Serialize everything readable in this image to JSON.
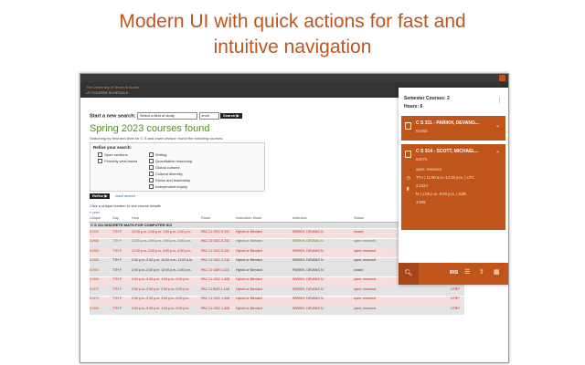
{
  "headline": {
    "line1": "Modern UI with quick actions for fast and",
    "line2": "intuitive navigation"
  },
  "site": {
    "logo_line1": "The University of Texas at Austin",
    "logo_line2": "UT COURSE SCHEDULE"
  },
  "search": {
    "label": "Start a new search:",
    "field_placeholder": "Select a field of study",
    "level_value": "level",
    "button": "Search ▶"
  },
  "results": {
    "title": "Spring 2023 courses found",
    "subtitle": "Searching by field and level for C S and lower-division found the following courses."
  },
  "refine": {
    "title": "Refine your search:",
    "options_left": [
      "Open sections",
      "Primarily web-based"
    ],
    "options_right": [
      "Writing",
      "Quantitative reasoning",
      "Global cultures",
      "Cultural diversity",
      "Ethics and leadership",
      "Independent inquiry"
    ],
    "button": "Refine ▶",
    "reset": "reset search"
  },
  "list": {
    "click_info": "Click a unique number to see course details.",
    "prev": "« prev",
    "headers": [
      "Unique",
      "Day",
      "Hour",
      "Room",
      "Instruction Mode",
      "Instructor",
      "Status",
      ""
    ],
    "course_header": "C S 311 DISCRETE MATH FOR COMPUTER SCI",
    "rows": [
      {
        "unique": "51940",
        "day": "TTH F",
        "hour": "12:30 p.m.-2:00 p.m. 1:00 p.m.-2:00 p.m.",
        "room": "PAC 21 GDC 6.202",
        "mode": "Hybrid or Blended",
        "instructor": "PARIKH, DEVANG N",
        "status": "closed",
        "flag": "",
        "style": "pink",
        "tone": "red"
      },
      {
        "unique": "51945",
        "day": "TTH F",
        "hour": "12:30 p.m.-2:00 p.m. 2:00 p.m.-3:00 p.m.",
        "room": "PAC 21 GDC 6.202",
        "mode": "Hybrid or Blended",
        "instructor": "PARIKH, DEVANG N",
        "status": "open; reserved",
        "flag": "",
        "style": "grey",
        "tone": "green"
      },
      {
        "unique": "51950",
        "day": "TTH F",
        "hour": "12:30 p.m.-2:00 p.m. 3:00 p.m.-4:00 p.m.",
        "room": "PAC 21 GDC 6.202",
        "mode": "Hybrid or Blended",
        "instructor": "PARIKH, DEVANG N",
        "status": "open; reserved",
        "flag": "",
        "style": "pink",
        "tone": "red"
      },
      {
        "unique": "51955",
        "day": "TTH F",
        "hour": "2:00 p.m.-3:30 p.m. 10:00 a.m.-11:00 a.m.",
        "room": "PAC 21 GDC 2.210",
        "mode": "Hybrid or Blended",
        "instructor": "PARIKH, DEVANG N",
        "status": "open; reserved",
        "flag": "UTRP",
        "style": "grey",
        "tone": "dark"
      },
      {
        "unique": "51960",
        "day": "TTH F",
        "hour": "2:00 p.m.-3:30 p.m. 12:00 p.m.-1:00 p.m.",
        "room": "PAC 21 GAR 3.116",
        "mode": "Hybrid or Blended",
        "instructor": "PARIKH, DEVANG N",
        "status": "closed",
        "flag": "UTRP",
        "style": "grey",
        "tone": "dark"
      },
      {
        "unique": "51965",
        "day": "TTH F",
        "hour": "3:00 p.m.-3:30 p.m. 1:00 p.m.-2:00 p.m.",
        "room": "PAC 21 GDC 1.406",
        "mode": "Hybrid or Blended",
        "instructor": "PARIKH, DEVANG N",
        "status": "open; reserved",
        "flag": "UTRP",
        "style": "pink",
        "tone": "red"
      },
      {
        "unique": "51970",
        "day": "TTH F",
        "hour": "2:00 p.m.-3:30 p.m. 2:00 p.m.-3:00 p.m.",
        "room": "PAC 21 BUR 1.108",
        "mode": "Hybrid or Blended",
        "instructor": "PARIKH, DEVANG N",
        "status": "open; reserved",
        "flag": "UTRP",
        "style": "grey",
        "tone": "red"
      },
      {
        "unique": "51975",
        "day": "TTH F",
        "hour": "2:00 p.m.-3:30 p.m. 3:00 p.m.-4:00 p.m.",
        "room": "PAC 21 GDC 1.406",
        "mode": "Hybrid or Blended",
        "instructor": "PARIKH, DEVANG N",
        "status": "open; reserved",
        "flag": "UTRP",
        "style": "pink",
        "tone": "red"
      },
      {
        "unique": "51980",
        "day": "TTH F",
        "hour": "3:00 p.m.-3:30 p.m. 1:00 p.m.-2:00 p.m.",
        "room": "PAC 21 GDC 1.406",
        "mode": "Hybrid or Blended",
        "instructor": "PARIKH, DEVANG N",
        "status": "open; reserved",
        "flag": "UTRP",
        "style": "grey",
        "tone": "red"
      }
    ]
  },
  "panel": {
    "semester": "Semester Courses: 2",
    "hours": "Hours: 6",
    "cards": [
      {
        "title": "C S 311 - PARIKH, DEVANG...",
        "unique": "51950"
      },
      {
        "title": "C S 314 - SCOTT, MICHAEL...",
        "unique": "52075",
        "status": "open; reserved",
        "time1": "TTH | 11:00 a.m.-12:30 p.m. | UTC",
        "room1": "2.102A",
        "time2": "M | 1:00 p.m.-2:00 p.m. | SZB",
        "room2": "3.508"
      }
    ],
    "toolbar": {
      "ris": "RIS"
    }
  },
  "colors": {
    "accent": "#c0551b",
    "closed_red": "#b8261c",
    "open_green": "#3c8a2e"
  }
}
